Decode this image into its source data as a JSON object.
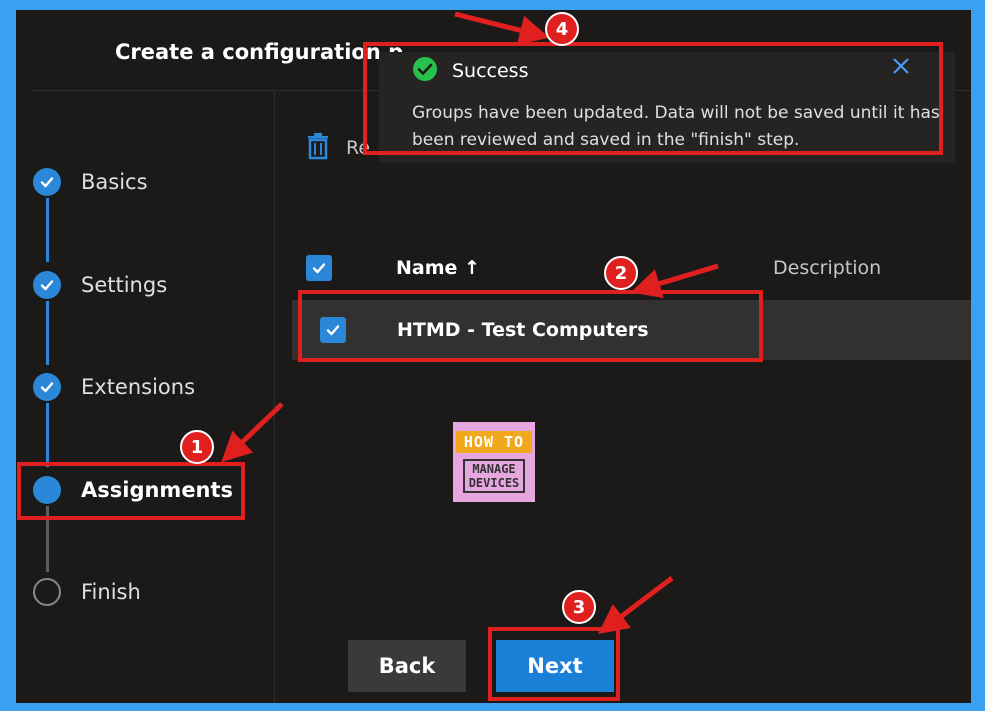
{
  "page": {
    "title": "Create a configuration p"
  },
  "stepper": [
    {
      "label": "Basics",
      "state": "done"
    },
    {
      "label": "Settings",
      "state": "done"
    },
    {
      "label": "Extensions",
      "state": "done"
    },
    {
      "label": "Assignments",
      "state": "current"
    },
    {
      "label": "Finish",
      "state": "todo"
    }
  ],
  "toolbar": {
    "remove_label": "Re",
    "remove_icon": "trash-icon"
  },
  "table": {
    "columns": {
      "name": "Name ↑",
      "description": "Description"
    },
    "rows": [
      {
        "name": "HTMD - Test Computers",
        "description": "",
        "checked": true
      }
    ]
  },
  "logo": {
    "top": "HOW TO",
    "line1": "MANAGE",
    "line2": "DEVICES"
  },
  "buttons": {
    "back": "Back",
    "next": "Next"
  },
  "toast": {
    "title": "Success",
    "message": "Groups have been updated. Data will not be saved until it has been reviewed and saved in the \"finish\" step.",
    "icon": "success-check-icon",
    "close_icon": "close-icon"
  },
  "annotations": {
    "badges": [
      "1",
      "2",
      "3",
      "4"
    ]
  },
  "colors": {
    "accent": "#2b88d8",
    "annotation": "#e0201f",
    "frame": "#3aa0f0",
    "success": "#27c24c"
  }
}
